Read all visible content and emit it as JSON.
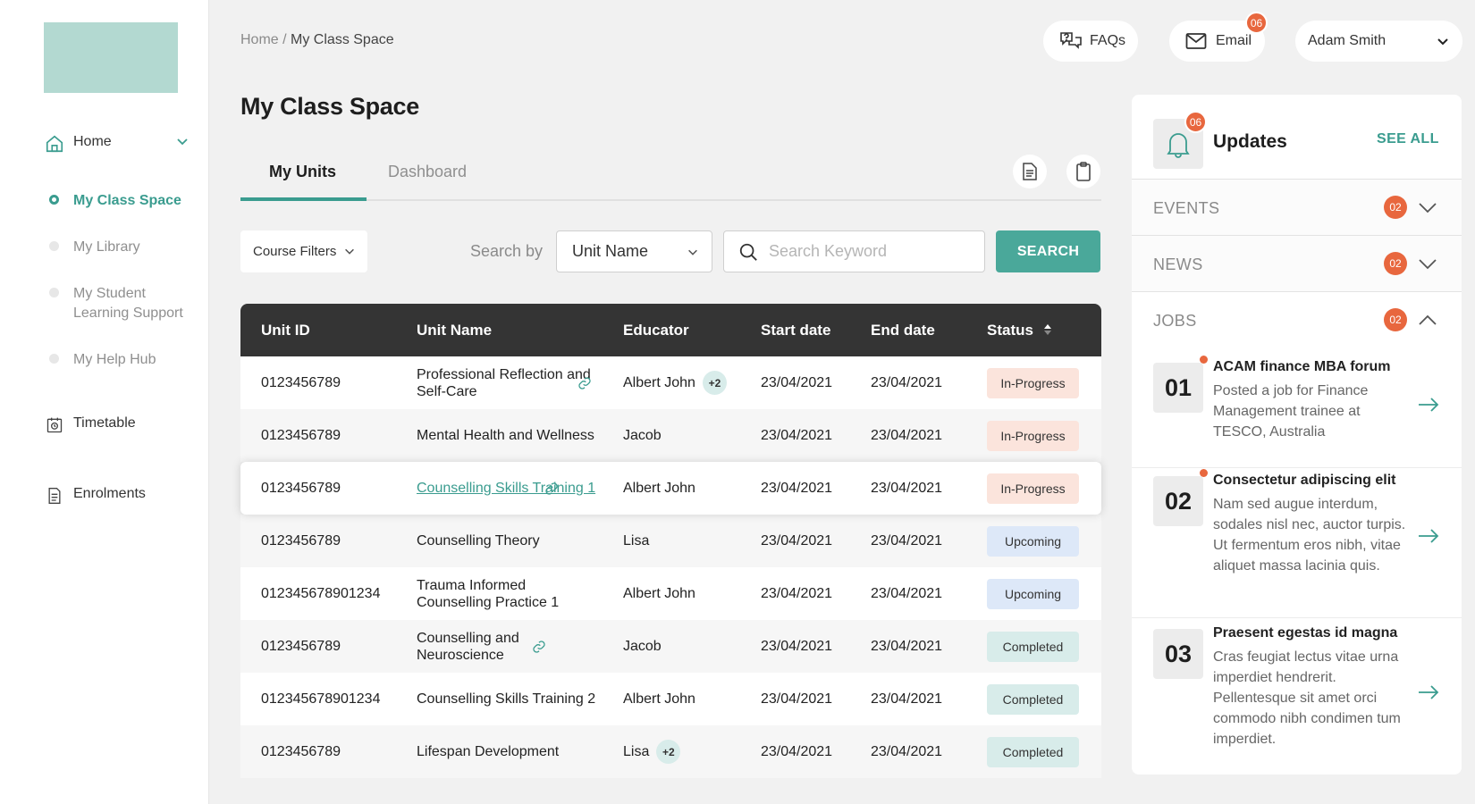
{
  "sidebar": {
    "home_label": "Home",
    "items": [
      {
        "label": "My Class Space",
        "active": true
      },
      {
        "label": "My Library",
        "active": false
      },
      {
        "label": "My Student Learning Support",
        "active": false
      },
      {
        "label": "My Help Hub",
        "active": false
      }
    ],
    "timetable_label": "Timetable",
    "enrolments_label": "Enrolments"
  },
  "header": {
    "breadcrumb_home": "Home",
    "breadcrumb_sep": " / ",
    "breadcrumb_current": "My Class Space",
    "faqs_label": "FAQs",
    "email_label": "Email",
    "email_badge": "06",
    "user_name": "Adam Smith"
  },
  "page_title": "My Class Space",
  "tabs": [
    {
      "label": "My Units",
      "active": true
    },
    {
      "label": "Dashboard",
      "active": false
    }
  ],
  "filters": {
    "course_filters_label": "Course Filters",
    "search_by_label": "Search by",
    "search_by_value": "Unit Name",
    "search_placeholder": "Search Keyword",
    "search_button": "SEARCH"
  },
  "table": {
    "headers": [
      "Unit ID",
      "Unit Name",
      "Educator",
      "Start date",
      "End date",
      "Status"
    ],
    "rows": [
      {
        "id": "0123456789",
        "name": "Professional Reflection and Self-Care",
        "link": true,
        "underlined": false,
        "educator": "Albert John",
        "extra": "+2",
        "start": "23/04/2021",
        "end": "23/04/2021",
        "status": "In-Progress"
      },
      {
        "id": "0123456789",
        "name": "Mental Health and Wellness",
        "link": false,
        "underlined": false,
        "educator": "Jacob",
        "extra": "",
        "start": "23/04/2021",
        "end": "23/04/2021",
        "status": "In-Progress"
      },
      {
        "id": "0123456789",
        "name": "Counselling Skills Training 1",
        "link": true,
        "underlined": true,
        "educator": "Albert John",
        "extra": "",
        "start": "23/04/2021",
        "end": "23/04/2021",
        "status": "In-Progress"
      },
      {
        "id": "0123456789",
        "name": "Counselling Theory",
        "link": false,
        "underlined": false,
        "educator": "Lisa",
        "extra": "",
        "start": "23/04/2021",
        "end": "23/04/2021",
        "status": "Upcoming"
      },
      {
        "id": "012345678901234",
        "name": "Trauma Informed Counselling Practice 1",
        "link": false,
        "underlined": false,
        "educator": "Albert John",
        "extra": "",
        "start": "23/04/2021",
        "end": "23/04/2021",
        "status": "Upcoming"
      },
      {
        "id": "0123456789",
        "name": "Counselling and Neuroscience",
        "link": true,
        "underlined": false,
        "educator": "Jacob",
        "extra": "",
        "start": "23/04/2021",
        "end": "23/04/2021",
        "status": "Completed"
      },
      {
        "id": "012345678901234",
        "name": "Counselling Skills Training 2",
        "link": false,
        "underlined": false,
        "educator": "Albert John",
        "extra": "",
        "start": "23/04/2021",
        "end": "23/04/2021",
        "status": "Completed"
      },
      {
        "id": "0123456789",
        "name": "Lifespan Development",
        "link": false,
        "underlined": false,
        "educator": "Lisa",
        "extra": "+2",
        "start": "23/04/2021",
        "end": "23/04/2021",
        "status": "Completed"
      }
    ]
  },
  "updates": {
    "title": "Updates",
    "badge": "06",
    "see_all": "SEE ALL",
    "sections": [
      {
        "label": "EVENTS",
        "count": "02",
        "expanded": false
      },
      {
        "label": "NEWS",
        "count": "02",
        "expanded": false
      },
      {
        "label": "JOBS",
        "count": "02",
        "expanded": true
      }
    ],
    "jobs": [
      {
        "num": "01",
        "title": "ACAM finance MBA forum",
        "desc": "Posted a job for Finance Management trainee at TESCO, Australia",
        "new": true
      },
      {
        "num": "02",
        "title": "Consectetur adipiscing elit",
        "desc": "Nam sed augue interdum, sodales nisl nec, auctor turpis. Ut fermentum eros nibh, vitae aliquet massa lacinia quis.",
        "new": true
      },
      {
        "num": "03",
        "title": "Praesent egestas id magna",
        "desc": "Cras feugiat lectus vitae urna imperdiet hendrerit. Pellentesque sit amet orci commodo nibh condimen tum imperdiet.",
        "new": false
      }
    ]
  },
  "colors": {
    "accent": "#3a9c8f",
    "badge": "#e8673e",
    "header_dark": "#343434"
  }
}
